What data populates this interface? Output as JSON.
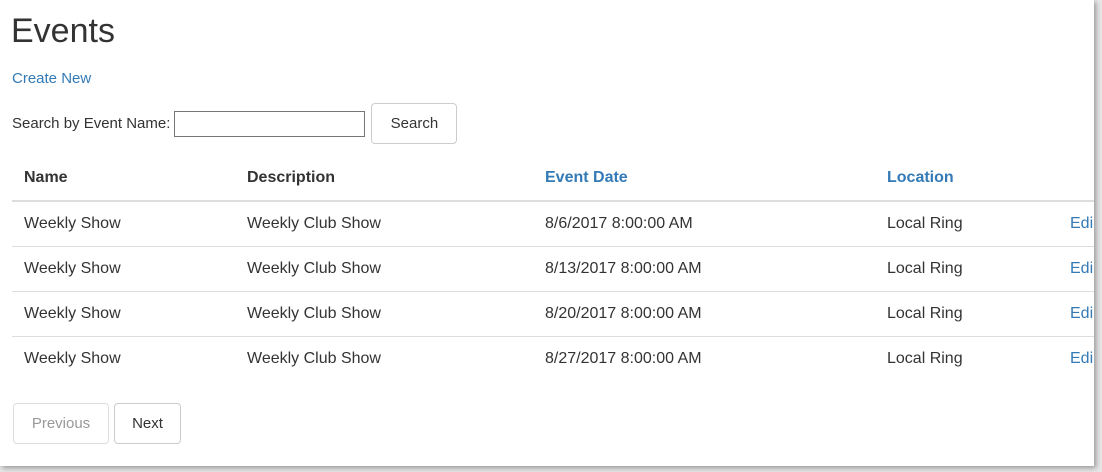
{
  "page": {
    "title": "Events",
    "create_link": "Create New"
  },
  "search": {
    "label": "Search by Event Name:",
    "value": "",
    "placeholder": "",
    "button_label": "Search"
  },
  "table": {
    "columns": [
      {
        "label": "Name",
        "sortable": false
      },
      {
        "label": "Description",
        "sortable": false
      },
      {
        "label": "Event Date",
        "sortable": true
      },
      {
        "label": "Location",
        "sortable": true
      },
      {
        "label": "",
        "sortable": false
      }
    ],
    "rows": [
      {
        "name": "Weekly Show",
        "description": "Weekly Club Show",
        "event_date": "8/6/2017 8:00:00 AM",
        "location": "Local Ring",
        "action": "Edi"
      },
      {
        "name": "Weekly Show",
        "description": "Weekly Club Show",
        "event_date": "8/13/2017 8:00:00 AM",
        "location": "Local Ring",
        "action": "Edi"
      },
      {
        "name": "Weekly Show",
        "description": "Weekly Club Show",
        "event_date": "8/20/2017 8:00:00 AM",
        "location": "Local Ring",
        "action": "Edi"
      },
      {
        "name": "Weekly Show",
        "description": "Weekly Club Show",
        "event_date": "8/27/2017 8:00:00 AM",
        "location": "Local Ring",
        "action": "Edi"
      }
    ]
  },
  "pager": {
    "previous_label": "Previous",
    "previous_enabled": false,
    "next_label": "Next",
    "next_enabled": true
  },
  "colors": {
    "link": "#337ab7",
    "text": "#333333",
    "disabled_text": "#999999",
    "border": "#dddddd"
  }
}
